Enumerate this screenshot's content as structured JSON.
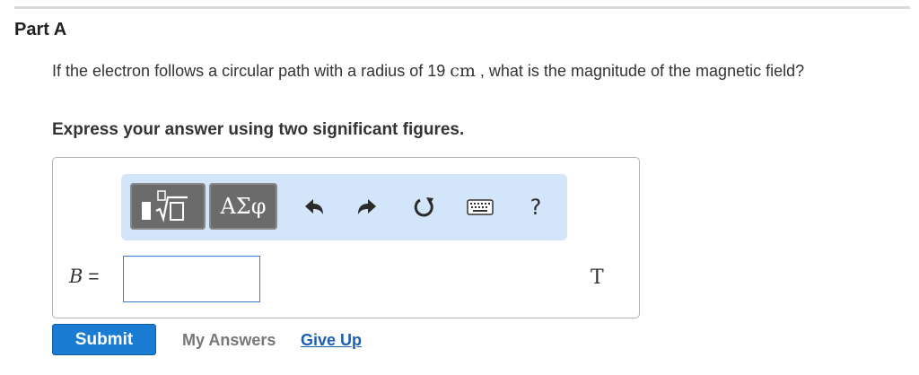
{
  "part": {
    "title": "Part A"
  },
  "question": {
    "text_before": "If the electron follows a circular path with a radius of 19 ",
    "unit": "cm",
    "text_after": " , what is the magnitude of the magnetic field?"
  },
  "instruction": "Express your answer using two significant figures.",
  "toolbar": {
    "greek_label": "ΑΣφ",
    "help_label": "?",
    "icons": [
      "templates-icon",
      "greek-letters-icon",
      "undo-icon",
      "redo-icon",
      "reset-icon",
      "keyboard-icon",
      "help-icon"
    ],
    "background_color": "#d3e5fb"
  },
  "answer": {
    "variable": "B",
    "equals": "=",
    "value": "",
    "unit": "T"
  },
  "actions": {
    "submit_label": "Submit",
    "my_answers_label": "My Answers",
    "give_up_label": "Give Up"
  },
  "colors": {
    "accent": "#1a7bd3",
    "link": "#1a5fb4"
  }
}
